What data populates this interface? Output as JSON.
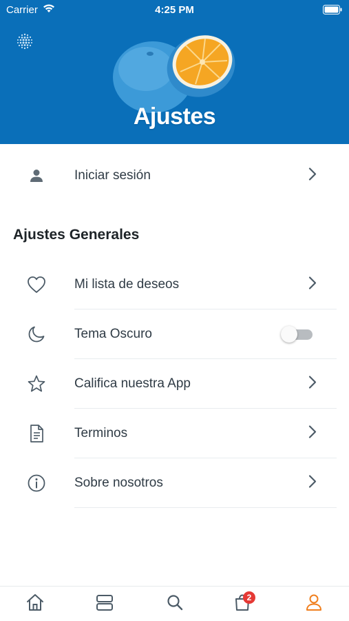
{
  "status_bar": {
    "carrier": "Carrier",
    "time": "4:25 PM"
  },
  "header": {
    "title": "Ajustes"
  },
  "login": {
    "label": "Iniciar sesión",
    "icon": "user-icon"
  },
  "section": {
    "title": "Ajustes Generales"
  },
  "settings": [
    {
      "label": "Mi lista de deseos",
      "icon": "heart-icon"
    },
    {
      "label": "Tema Oscuro",
      "icon": "moon-icon",
      "toggle": false
    },
    {
      "label": "Califica nuestra App",
      "icon": "star-icon"
    },
    {
      "label": "Terminos",
      "icon": "document-icon"
    },
    {
      "label": "Sobre nosotros",
      "icon": "info-icon"
    }
  ],
  "tabbar": {
    "items": [
      "home-icon",
      "list-icon",
      "search-icon",
      "cart-icon",
      "user-icon"
    ],
    "cart_badge": "2",
    "active_color": "#f07f1e"
  },
  "colors": {
    "header_bg": "#0a6fb9",
    "text": "#2f3b45",
    "icon": "#4b5a66"
  }
}
